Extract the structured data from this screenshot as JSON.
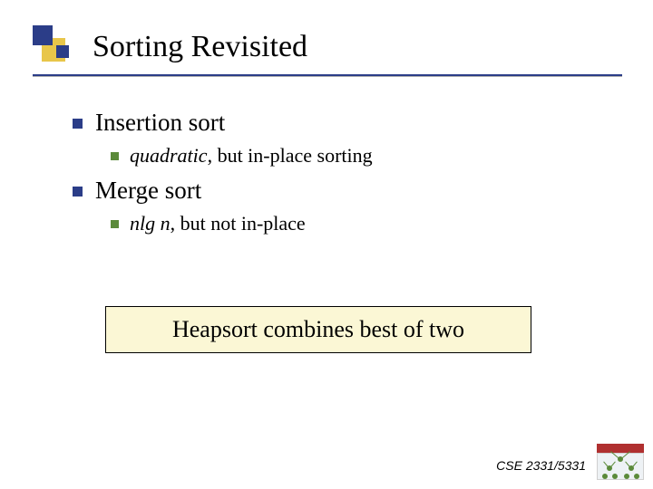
{
  "title": "Sorting Revisited",
  "body": {
    "insertion": {
      "label": "Insertion sort",
      "sub": {
        "italic": "quadratic",
        "rest": ", but in-place sorting"
      }
    },
    "merge": {
      "label": "Merge sort",
      "sub": {
        "italic": "nlg n",
        "rest": ", but not in-place"
      }
    }
  },
  "callout": "Heapsort combines best of two",
  "footer": {
    "course": "CSE 2331/5331"
  }
}
